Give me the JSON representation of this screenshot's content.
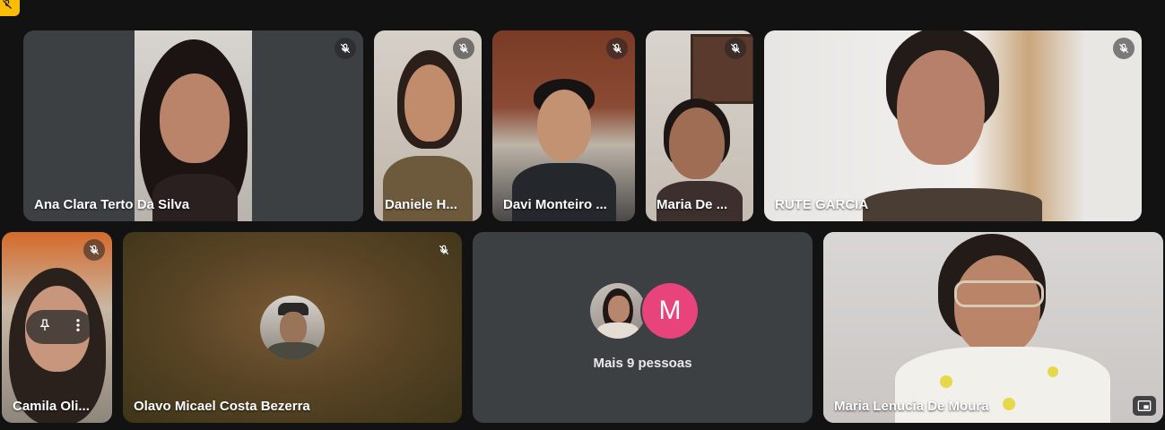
{
  "participants": [
    {
      "id": "ana",
      "name": "Ana Clara Terto Da Silva",
      "muted": true
    },
    {
      "id": "daniele",
      "name": "Daniele H...",
      "muted": true
    },
    {
      "id": "davi",
      "name": "Davi Monteiro ...",
      "muted": true
    },
    {
      "id": "mariade",
      "name": "Maria De ...",
      "muted": true
    },
    {
      "id": "rute",
      "name": "RUTE GARCIA",
      "muted": true
    },
    {
      "id": "camila",
      "name": "Camila Oli...",
      "muted": true
    },
    {
      "id": "olavo",
      "name": "Olavo Micael Costa Bezerra",
      "muted": true
    },
    {
      "id": "lenucia",
      "name": "Maria Lenucia De Moura",
      "muted": false
    }
  ],
  "more_tile": {
    "label": "Mais 9 pessoas",
    "avatar_initial": "M",
    "avatar_color": "#e8437a"
  },
  "colors": {
    "background": "#121212",
    "tile": "#3c4043",
    "active_border": "#a8c7fa",
    "badge": "#fbbc04"
  },
  "icons": {
    "mic_off": "mic-off-icon",
    "pin": "pin-icon",
    "more": "more-vert-icon",
    "pip": "picture-in-picture-icon"
  }
}
